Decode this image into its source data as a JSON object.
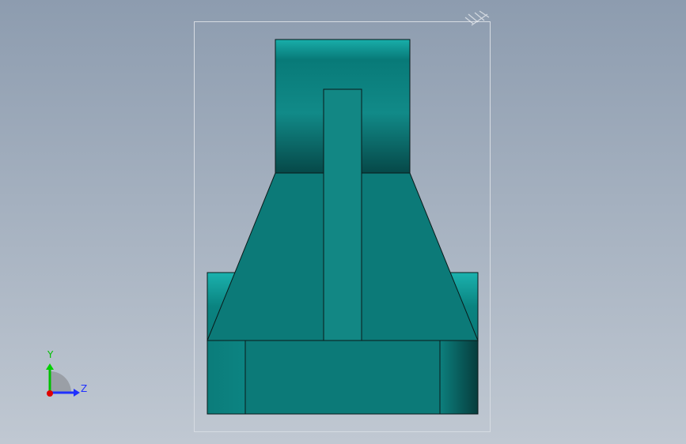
{
  "triad": {
    "y_label": "Y",
    "z_label": "Z",
    "y_color": "#00c000",
    "z_color": "#2030ff",
    "x_color": "#e00000"
  },
  "colors": {
    "model_teal": "#0b7a78",
    "model_teal_light": "#12a8a4",
    "model_teal_dark": "#07504f",
    "edge": "#0a1a1a",
    "background_top": "#8d9caf",
    "background_bottom": "#c0c8d2",
    "bbox_line": "#d6dbe2"
  }
}
